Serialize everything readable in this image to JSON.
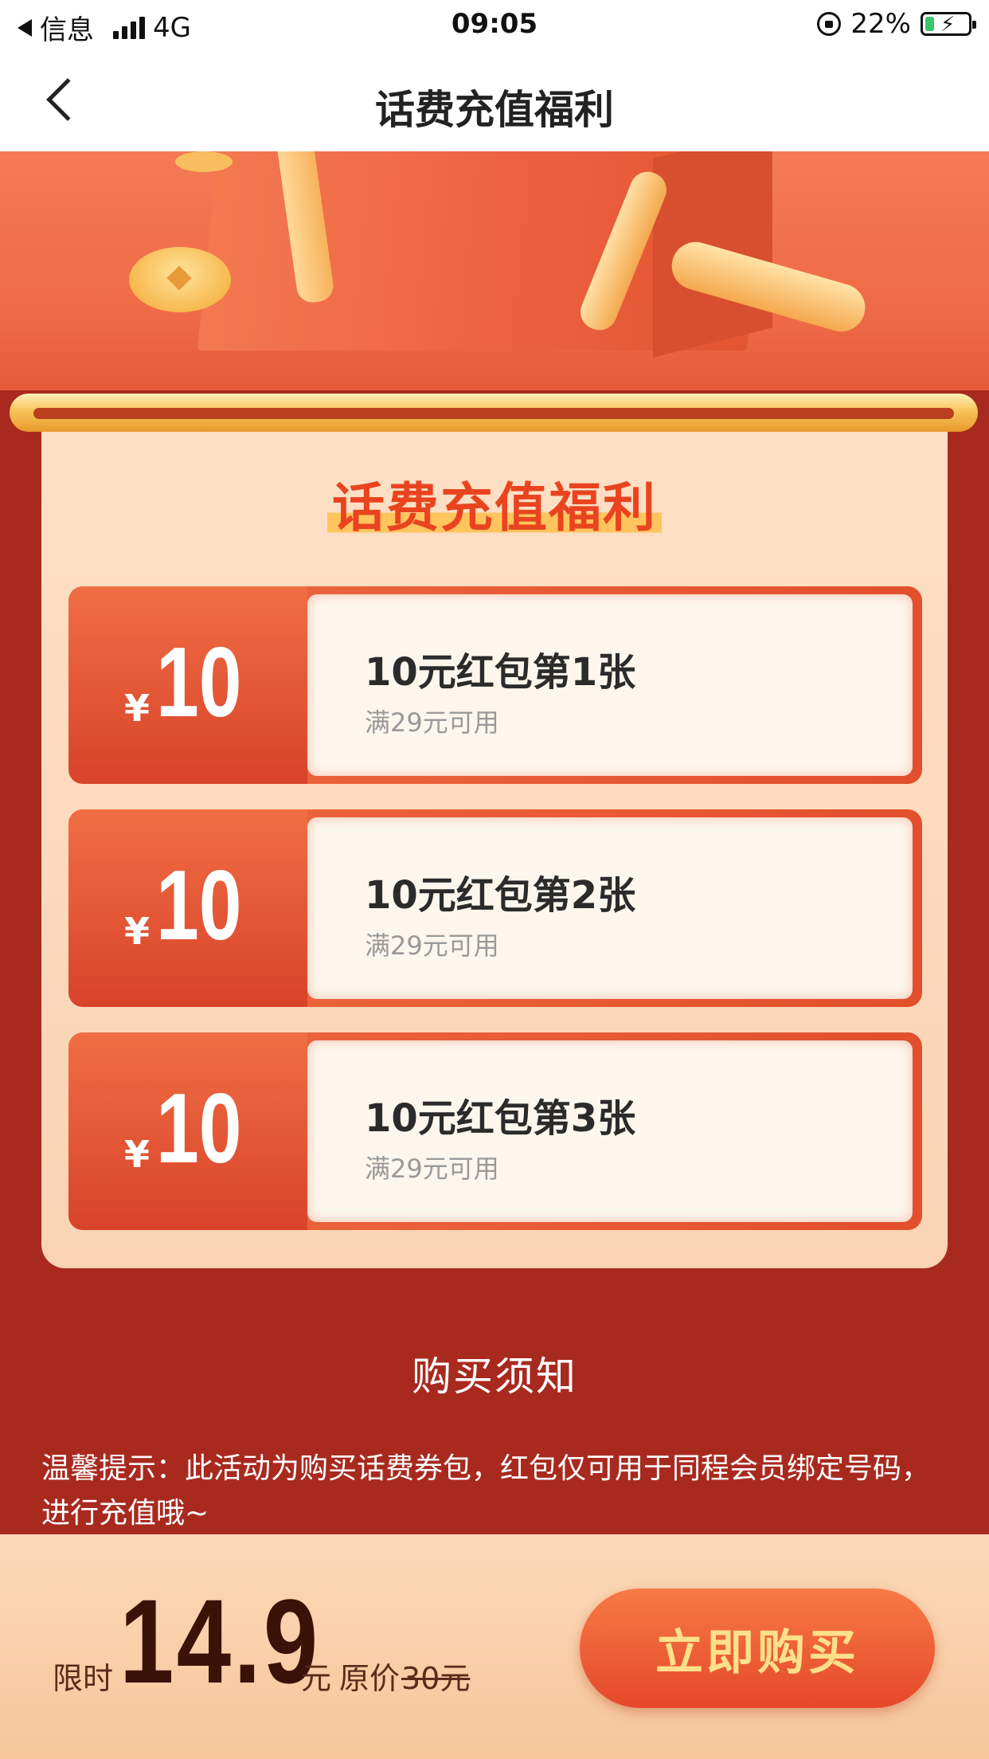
{
  "status_bar": {
    "back_app": "信息",
    "network": "4G",
    "time": "09:05",
    "battery_percent": "22%",
    "battery_level": 0.22
  },
  "nav": {
    "title": "话费充值福利"
  },
  "panel": {
    "title": "话费充值福利",
    "coupons": [
      {
        "currency": "¥",
        "amount": "10",
        "name": "10元红包第1张",
        "condition": "满29元可用"
      },
      {
        "currency": "¥",
        "amount": "10",
        "name": "10元红包第2张",
        "condition": "满29元可用"
      },
      {
        "currency": "¥",
        "amount": "10",
        "name": "10元红包第3张",
        "condition": "满29元可用"
      }
    ]
  },
  "notes": {
    "title": "购买须知",
    "text": "温馨提示：此活动为购买话费券包，红包仅可用于同程会员绑定号码，进行充值哦~"
  },
  "footer": {
    "price_prefix": "限时",
    "price": "14.9",
    "price_unit": "元",
    "original_label": "原价",
    "original_price": "30元",
    "buy_label": "立即购买"
  },
  "colors": {
    "page_bg": "#a82a1f",
    "accent_red": "#e9441f",
    "button_text": "#ffe08a",
    "battery_green": "#3cc46c"
  }
}
